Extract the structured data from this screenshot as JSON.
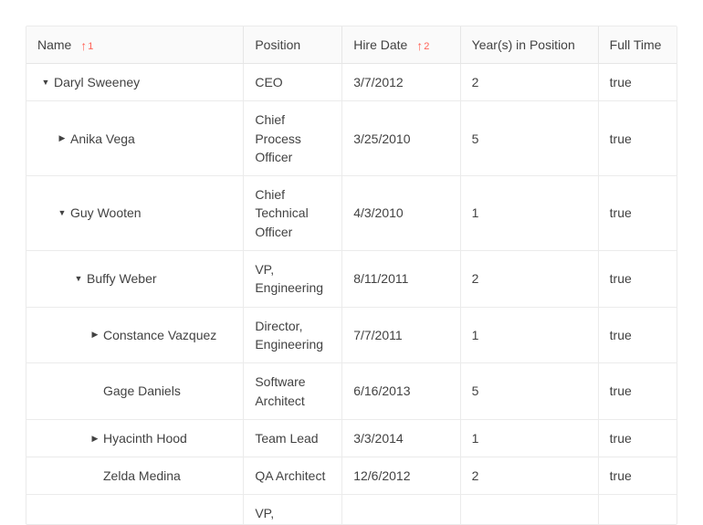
{
  "columns": [
    {
      "label": "Name",
      "sortIndex": "1"
    },
    {
      "label": "Position"
    },
    {
      "label": "Hire Date",
      "sortIndex": "2"
    },
    {
      "label": "Year(s) in Position"
    },
    {
      "label": "Full Time"
    }
  ],
  "rows": [
    {
      "indent": 0,
      "expand": "down",
      "name": "Daryl Sweeney",
      "position": "CEO",
      "hireDate": "3/7/2012",
      "years": "2",
      "fullTime": "true"
    },
    {
      "indent": 1,
      "expand": "right",
      "name": "Anika Vega",
      "position": "Chief Process Officer",
      "hireDate": "3/25/2010",
      "years": "5",
      "fullTime": "true"
    },
    {
      "indent": 1,
      "expand": "down",
      "name": "Guy Wooten",
      "position": "Chief Technical Officer",
      "hireDate": "4/3/2010",
      "years": "1",
      "fullTime": "true"
    },
    {
      "indent": 2,
      "expand": "down",
      "name": "Buffy Weber",
      "position": "VP, Engineering",
      "hireDate": "8/11/2011",
      "years": "2",
      "fullTime": "true"
    },
    {
      "indent": 3,
      "expand": "right",
      "name": "Constance Vazquez",
      "position": "Director, Engineering",
      "hireDate": "7/7/2011",
      "years": "1",
      "fullTime": "true"
    },
    {
      "indent": 3,
      "expand": "none",
      "name": "Gage Daniels",
      "position": "Software Architect",
      "hireDate": "6/16/2013",
      "years": "5",
      "fullTime": "true"
    },
    {
      "indent": 3,
      "expand": "right",
      "name": "Hyacinth Hood",
      "position": "Team Lead",
      "hireDate": "3/3/2014",
      "years": "1",
      "fullTime": "true"
    },
    {
      "indent": 3,
      "expand": "none",
      "name": "Zelda Medina",
      "position": "QA Architect",
      "hireDate": "12/6/2012",
      "years": "2",
      "fullTime": "true"
    },
    {
      "indent": 2,
      "expand": "none",
      "name": "",
      "position": "VP,",
      "hireDate": "",
      "years": "",
      "fullTime": ""
    }
  ]
}
